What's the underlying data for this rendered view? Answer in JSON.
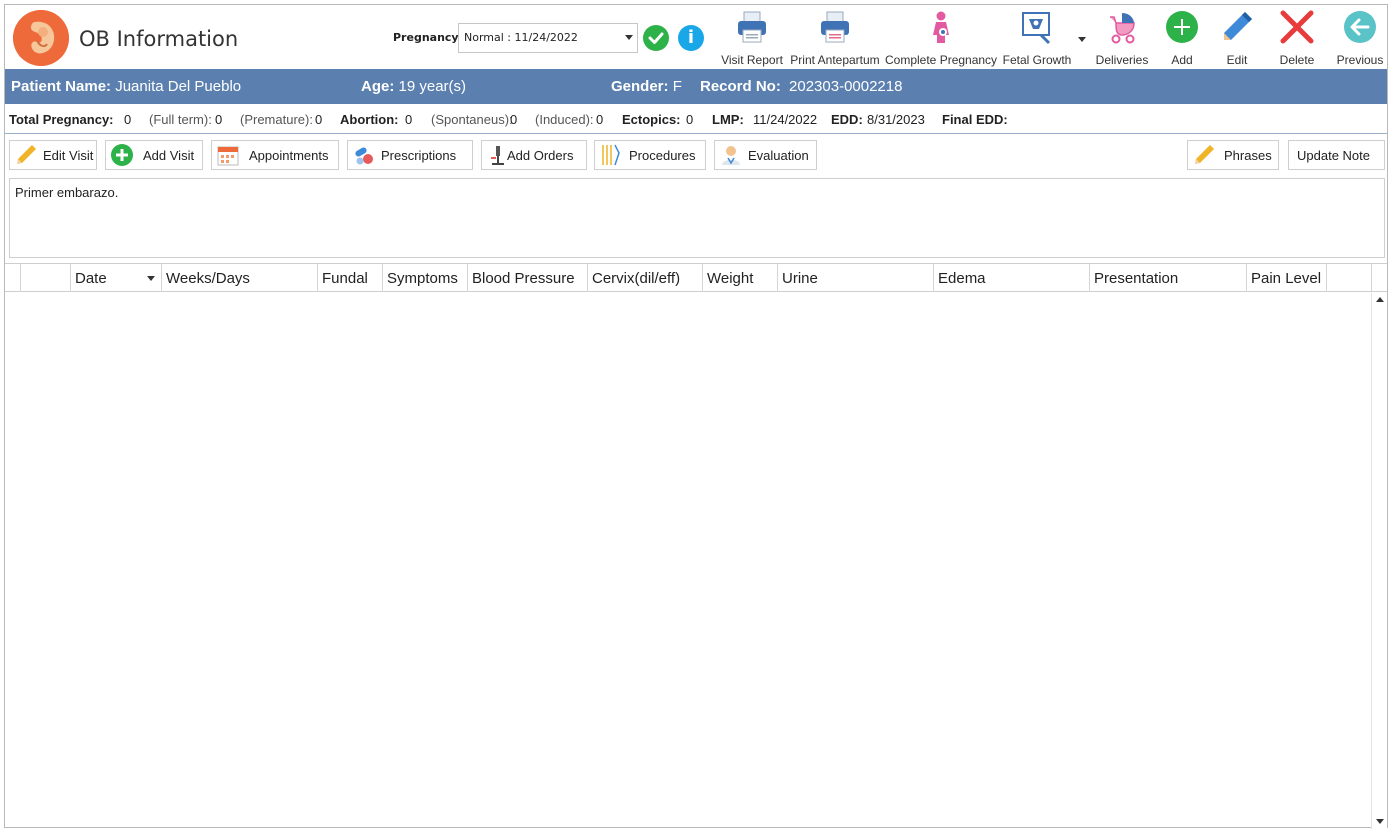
{
  "app": {
    "title": "OB Information"
  },
  "pregnancy": {
    "label": "Pregnancy:",
    "selected": "Normal : 11/24/2022"
  },
  "toolbar": {
    "visit_report": "Visit Report",
    "print_antepartum": "Print Antepartum",
    "complete_pregnancy": "Complete Pregnancy",
    "fetal_growth": "Fetal Growth",
    "deliveries": "Deliveries",
    "add": "Add",
    "edit": "Edit",
    "delete": "Delete",
    "previous": "Previous"
  },
  "patient": {
    "name_label": "Patient Name:",
    "name": "Juanita Del Pueblo",
    "age_label": "Age:",
    "age": "19 year(s)",
    "gender_label": "Gender:",
    "gender": "F",
    "record_label": "Record No:",
    "record": "202303-0002218"
  },
  "stats": {
    "total_label": "Total Pregnancy:",
    "total": "0",
    "fullterm_label": "(Full term):",
    "fullterm": "0",
    "premature_label": "(Premature):",
    "premature": "0",
    "abortion_label": "Abortion:",
    "abortion": "0",
    "spontaneus_label": "(Spontaneus):",
    "spontaneus": "0",
    "induced_label": "(Induced):",
    "induced": "0",
    "ectopics_label": "Ectopics:",
    "ectopics": "0",
    "lmp_label": "LMP:",
    "lmp": "11/24/2022",
    "edd_label": "EDD:",
    "edd": "8/31/2023",
    "final_edd_label": "Final EDD:",
    "final_edd": ""
  },
  "actions": {
    "edit_visit": "Edit Visit",
    "add_visit": "Add Visit",
    "appointments": "Appointments",
    "prescriptions": "Prescriptions",
    "add_orders": "Add Orders",
    "procedures": "Procedures",
    "evaluation": "Evaluation",
    "phrases": "Phrases",
    "update_note": "Update Note"
  },
  "note": {
    "text": "Primer embarazo."
  },
  "grid": {
    "columns": [
      "Date",
      "Weeks/Days",
      "Fundal",
      "Symptoms",
      "Blood Pressure",
      "Cervix(dil/eff)",
      "Weight",
      "Urine",
      "Edema",
      "Presentation",
      "Pain Level"
    ],
    "rows": []
  },
  "colors": {
    "patient_bar": "#5b80b0",
    "logo": "#ef6a3a",
    "check": "#2db24a",
    "info": "#19a7e7",
    "add": "#2db24a",
    "delete": "#e83b3b",
    "previous": "#5ac3c8"
  },
  "icons": [
    "fetus-logo-icon",
    "check-icon",
    "info-icon",
    "printer-icon",
    "pregnant-woman-icon",
    "fetal-ultrasound-icon",
    "stroller-icon",
    "add-circle-icon",
    "pencil-icon",
    "delete-x-icon",
    "back-arrow-icon",
    "calendar-icon",
    "pills-icon",
    "microscope-icon",
    "instruments-icon",
    "doctor-icon"
  ]
}
